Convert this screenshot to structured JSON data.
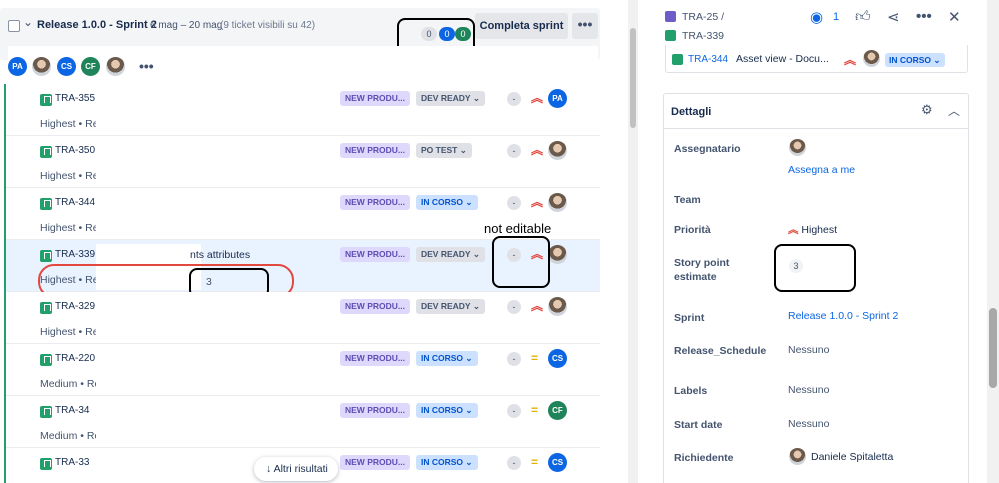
{
  "sprint": {
    "title": "Release 1.0.0 - Sprint 2",
    "dates": "6 mag – 20 mag",
    "count": "(9 ticket visibili su 42)",
    "counters": [
      "0",
      "0",
      "0"
    ],
    "complete_label": "Completa sprint",
    "more_label": "•••"
  },
  "avatars": [
    "PA",
    "CS",
    "CF",
    "•••"
  ],
  "annotation_not_editable": "not editable",
  "issues": [
    {
      "key": "TRA-355",
      "sub": "Highest • Re",
      "epic": "NEW PRODU...",
      "status": "DEV READY",
      "est": "-",
      "prio": "high",
      "assignee": "PA"
    },
    {
      "key": "TRA-350",
      "sub": "Highest • Re",
      "epic": "NEW PRODU...",
      "status": "PO TEST",
      "est": "-",
      "prio": "high",
      "assignee": "photo"
    },
    {
      "key": "TRA-344",
      "sub": "Highest • Re",
      "epic": "NEW PRODU...",
      "status": "IN CORSO",
      "est": "-",
      "prio": "high",
      "assignee": "photo"
    },
    {
      "key": "TRA-339",
      "sub": "Highest • Re",
      "summary": "nts attributes",
      "inline_estimate": "3",
      "epic": "NEW PRODU...",
      "status": "DEV READY",
      "est": "-",
      "prio": "high",
      "assignee": "photo"
    },
    {
      "key": "TRA-329",
      "sub": "Highest • Re",
      "epic": "NEW PRODU...",
      "status": "DEV READY",
      "est": "-",
      "prio": "high",
      "assignee": "photo"
    },
    {
      "key": "TRA-220",
      "sub": "Medium • Re",
      "epic": "NEW PRODU...",
      "status": "IN CORSO",
      "est": "-",
      "prio": "medium",
      "assignee": "CS"
    },
    {
      "key": "TRA-34",
      "sub": "Medium • Re",
      "epic": "NEW PRODU...",
      "status": "IN CORSO",
      "est": "-",
      "prio": "medium",
      "assignee": "CF"
    },
    {
      "key": "TRA-33",
      "sub": "",
      "epic": "NEW PRODU...",
      "status": "IN CORSO",
      "est": "-",
      "prio": "medium",
      "assignee": "CS"
    }
  ],
  "float_button": "Altri risultati",
  "panel": {
    "parent_key": "TRA-25",
    "breadcrumb_sep": "/",
    "issue_key": "TRA-339",
    "watch_count": "1",
    "linked": {
      "key": "TRA-344",
      "summary": "Asset view - Docu...",
      "status": "IN CORSO"
    },
    "details_title": "Dettagli",
    "fields": {
      "assignee_label": "Assegnatario",
      "assign_me": "Assegna a me",
      "team_label": "Team",
      "priority_label": "Priorità",
      "priority_value": "Highest",
      "story_points_label": "Story point estimate",
      "story_points_value": "3",
      "sprint_label": "Sprint",
      "sprint_value": "Release 1.0.0 - Sprint 2",
      "release_label": "Release_Schedule",
      "release_value": "Nessuno",
      "labels_label": "Labels",
      "labels_value": "Nessuno",
      "start_label": "Start date",
      "start_value": "Nessuno",
      "requester_label": "Richiedente",
      "requester_value": "Daniele Spitaletta"
    }
  },
  "colors": {
    "primary": "#0c66e4",
    "story": "#22a06b",
    "priority_high": "#e2483d",
    "priority_medium": "#e2b203",
    "epic_bg": "#dfd8fd",
    "annotation_red": "#e2483d"
  }
}
